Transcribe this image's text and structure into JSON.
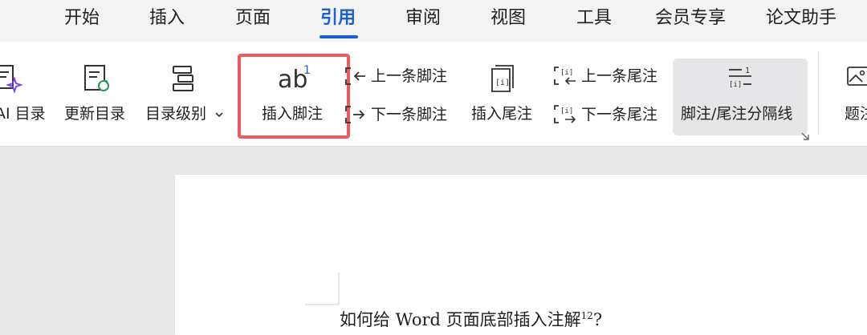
{
  "tabs": [
    "开始",
    "插入",
    "页面",
    "引用",
    "审阅",
    "视图",
    "工具",
    "会员专享",
    "论文助手"
  ],
  "active_tab": "引用",
  "ribbon": {
    "ai_toc": "AI 目录",
    "update_toc": "更新目录",
    "toc_level": "目录级别",
    "insert_footnote": "插入脚注",
    "footnote_superscript": "1",
    "prev_footnote": "上一条脚注",
    "next_footnote": "下一条脚注",
    "insert_endnote": "插入尾注",
    "prev_endnote": "上一条尾注",
    "next_endnote": "下一条尾注",
    "separator": "脚注/尾注分隔线",
    "caption": "题注"
  },
  "document": {
    "text": "如何给 Word 页面底部插入注解",
    "sup": "12",
    "end": "?"
  },
  "colors": {
    "accent": "#1a5fd6",
    "highlight": "#ee5b5f",
    "ai_purple": "#7a3cf0",
    "refresh_green": "#1f9a4a"
  }
}
